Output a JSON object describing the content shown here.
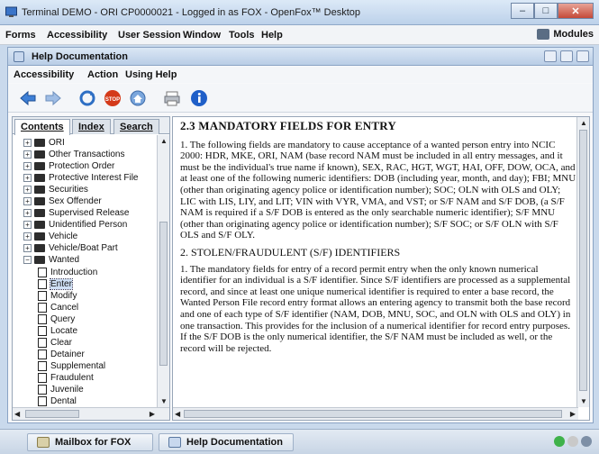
{
  "window": {
    "title": "Terminal DEMO - ORI CP0000021 - Logged in as FOX - OpenFox™ Desktop"
  },
  "main_menu": {
    "items": [
      "Forms",
      "Accessibility",
      "User Session",
      "Window",
      "Tools",
      "Help"
    ],
    "modules_label": "Modules"
  },
  "help_window": {
    "title": "Help Documentation",
    "menu": [
      "Accessibility",
      "Action",
      "Using Help"
    ],
    "toolbar": [
      "back-arrow-icon",
      "forward-arrow-icon",
      "refresh-icon",
      "stop-icon",
      "home-icon",
      "print-icon",
      "info-icon"
    ]
  },
  "tabs": [
    "Contents",
    "Index",
    "Search"
  ],
  "tree": {
    "folders": [
      "ORI",
      "Other Transactions",
      "Protection Order",
      "Protective Interest File",
      "Securities",
      "Sex Offender",
      "Supervised Release",
      "Unidentified Person",
      "Vehicle",
      "Vehicle/Boat Part",
      "Wanted"
    ],
    "wanted_children": [
      "Introduction",
      "Enter",
      "Modify",
      "Cancel",
      "Query",
      "Locate",
      "Clear",
      "Detainer",
      "Supplemental",
      "Fraudulent",
      "Juvenile",
      "Dental"
    ],
    "selected": "Enter"
  },
  "content": {
    "heading": "2.3 MANDATORY FIELDS FOR ENTRY",
    "para1": "1. The following fields are mandatory to cause acceptance of a wanted person entry into NCIC 2000: HDR, MKE, ORI, NAM (base record NAM must be included in all entry messages, and it must be the individual's true name if known), SEX, RAC, HGT, WGT, HAI, OFF, DOW, OCA, and at least one of the following numeric identifiers: DOB (including year, month, and day); FBI; MNU (other than originating agency police or identification number); SOC; OLN with OLS and OLY; LIC with LIS, LIY, and LIT; VIN with VYR, VMA, and VST; or S/F NAM and S/F DOB, (a S/F NAM is required if a S/F DOB is entered as the only searchable numeric identifier); S/F MNU (other than originating agency police or identification number); S/F SOC; or S/F OLN with S/F OLS and S/F OLY.",
    "subheading": "2. STOLEN/FRAUDULENT (S/F) IDENTIFIERS",
    "para2": "1. The mandatory fields for entry of a record permit entry when the only known numerical identifier for an individual is a S/F identifier. Since S/F identifiers are processed as a supplemental record, and since at least one unique numerical identifier is required to enter a base record, the Wanted Person File record entry format allows an entering agency to transmit both the base record and one of each type of S/F identifier (NAM, DOB, MNU, SOC, and OLN with OLS and OLY) in one transaction. This provides for the inclusion of a numerical identifier for record entry purposes. If the S/F DOB is the only numerical identifier, the S/F NAM must be included as well, or the record will be rejected."
  },
  "taskbar": {
    "tasks": [
      "Mailbox for FOX",
      "Help Documentation"
    ]
  },
  "colors": {
    "stop": "#d43a1a",
    "info": "#1f5fc8",
    "folder": "#2d2d2d"
  }
}
